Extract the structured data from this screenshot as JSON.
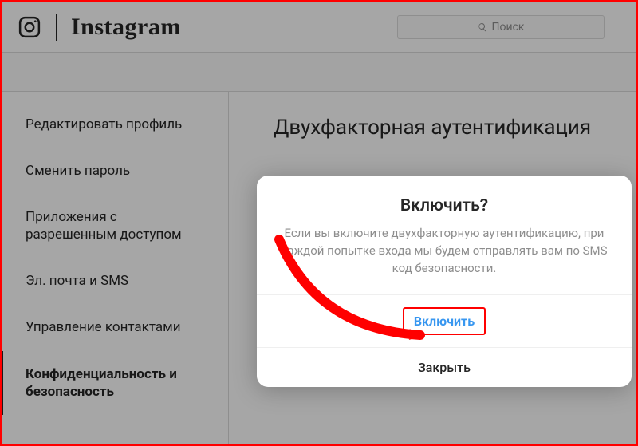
{
  "header": {
    "brand": "Instagram",
    "search_placeholder": "Поиск"
  },
  "sidebar": {
    "items": [
      {
        "label": "Редактировать профиль"
      },
      {
        "label": "Сменить пароль"
      },
      {
        "label": "Приложения с разрешенным доступом"
      },
      {
        "label": "Эл. почта и SMS"
      },
      {
        "label": "Управление контактами"
      },
      {
        "label": "Конфиденциальность и безопасность"
      }
    ],
    "active_index": 5
  },
  "main": {
    "title": "Двухфакторная аутентификация"
  },
  "modal": {
    "title": "Включить?",
    "description": "Если вы включите двухфакторную аутентификацию, при каждой попытке входа мы будем отправлять вам по SMS код безопасности.",
    "primary_label": "Включить",
    "secondary_label": "Закрыть"
  },
  "annotation": {
    "arrow_color": "#ff0000"
  }
}
